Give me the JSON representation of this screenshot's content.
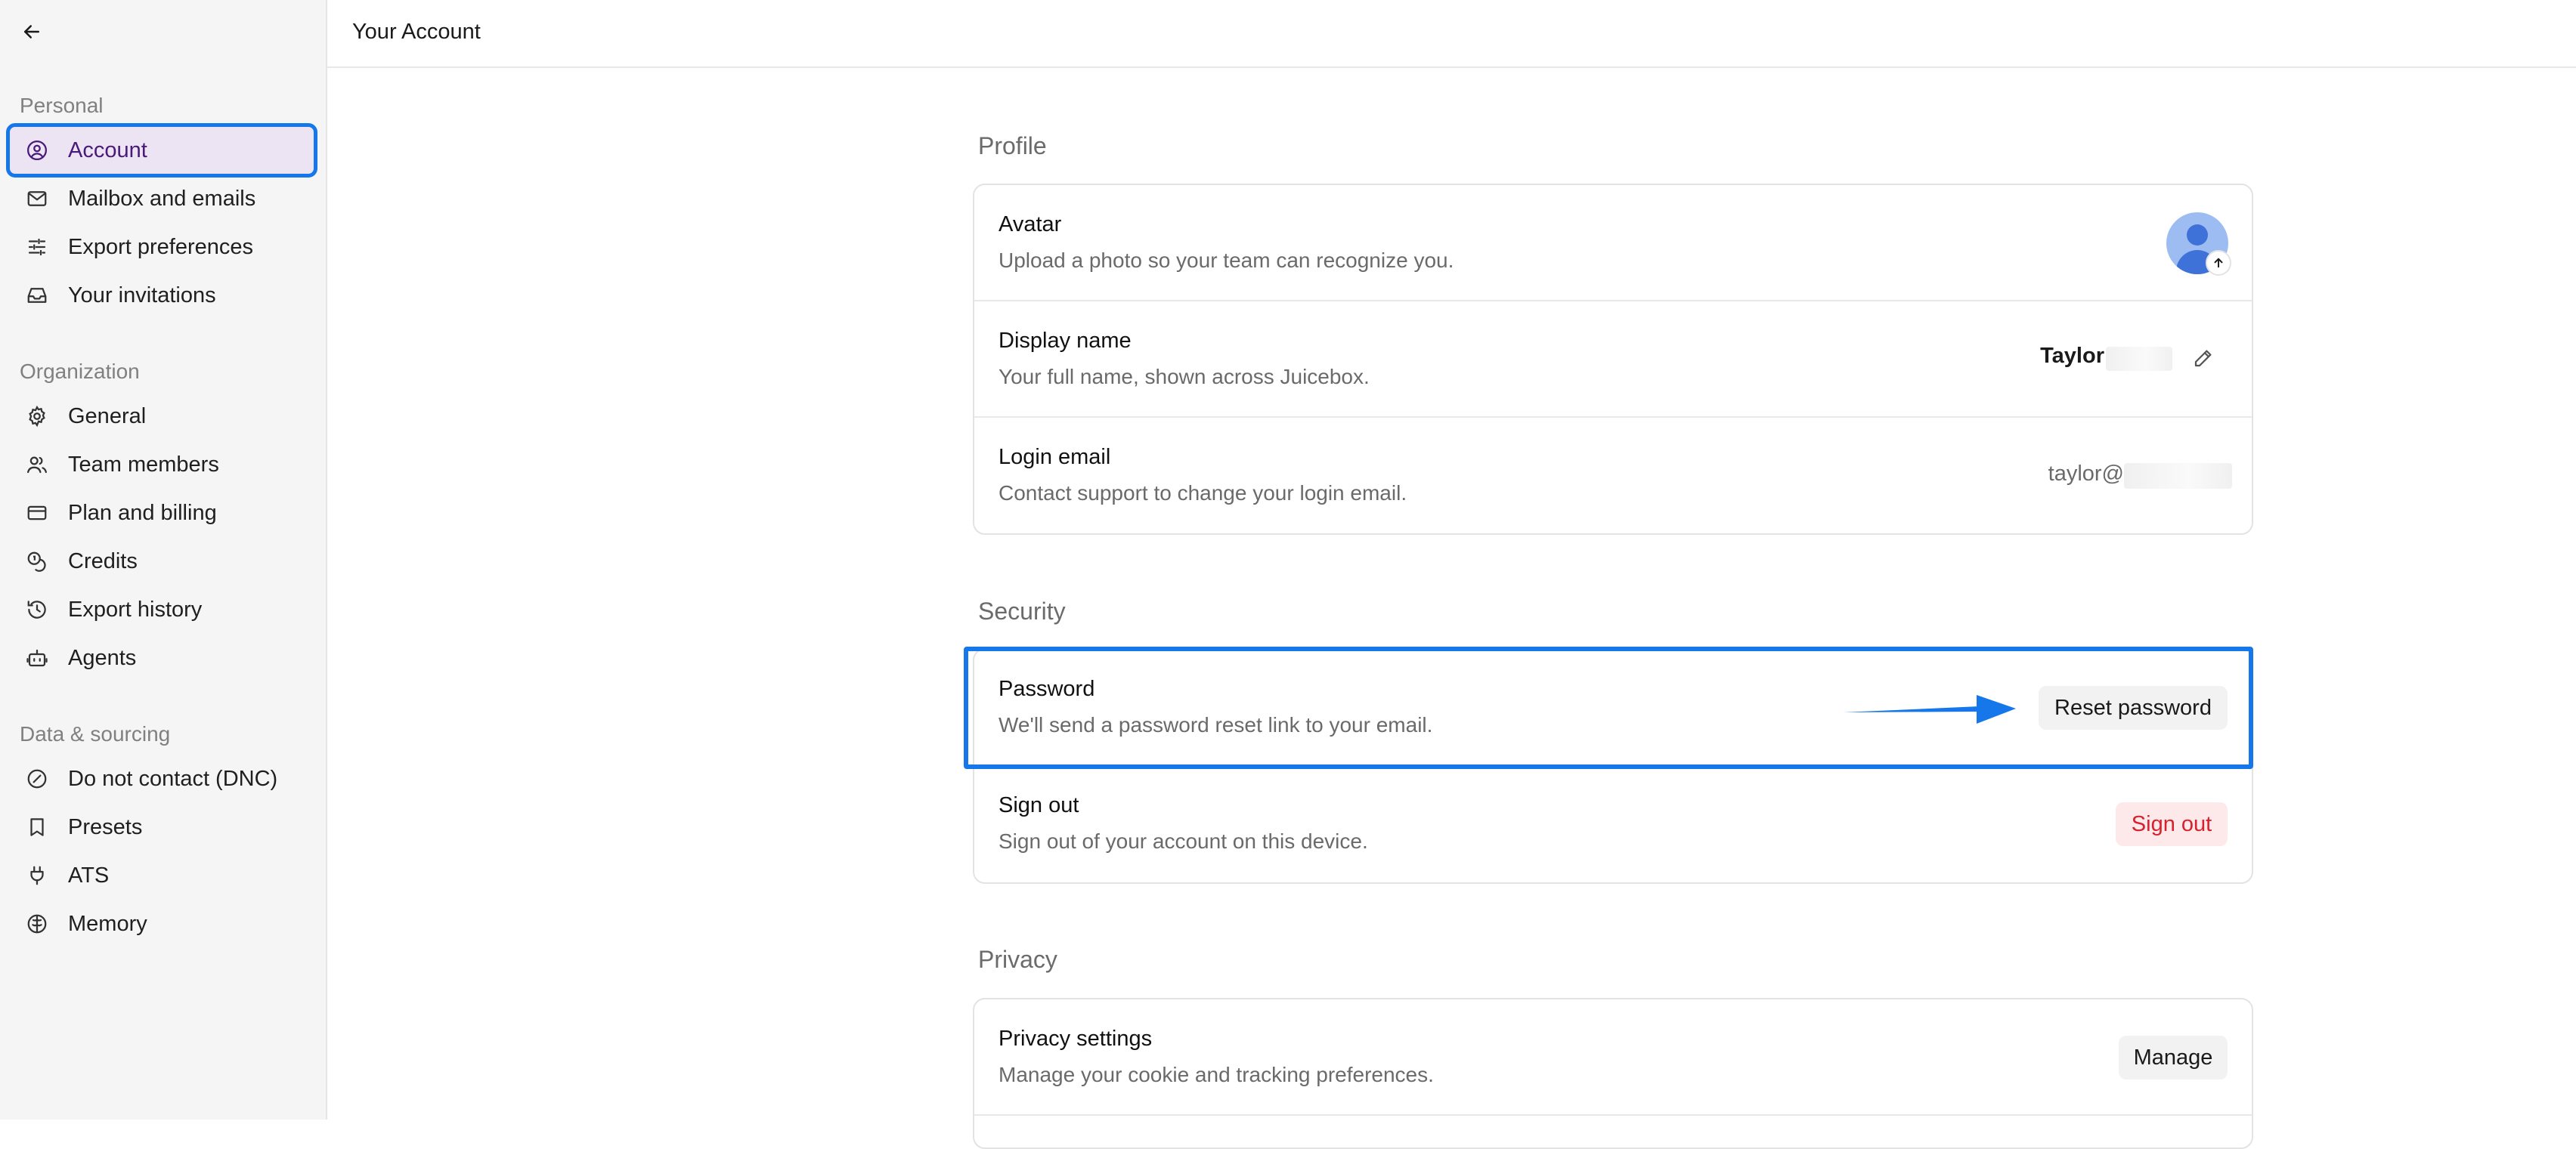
{
  "topbar": {
    "title": "Your Account"
  },
  "sidebar": {
    "groups": [
      {
        "label": "Personal",
        "items": [
          {
            "label": "Account",
            "icon": "user-circle-icon"
          },
          {
            "label": "Mailbox and emails",
            "icon": "mail-icon"
          },
          {
            "label": "Export preferences",
            "icon": "sliders-icon"
          },
          {
            "label": "Your invitations",
            "icon": "inbox-icon"
          }
        ]
      },
      {
        "label": "Organization",
        "items": [
          {
            "label": "General",
            "icon": "gear-icon"
          },
          {
            "label": "Team members",
            "icon": "users-icon"
          },
          {
            "label": "Plan and billing",
            "icon": "credit-card-icon"
          },
          {
            "label": "Credits",
            "icon": "coins-icon"
          },
          {
            "label": "Export history",
            "icon": "history-icon"
          },
          {
            "label": "Agents",
            "icon": "bot-icon"
          }
        ]
      },
      {
        "label": "Data & sourcing",
        "items": [
          {
            "label": "Do not contact (DNC)",
            "icon": "ban-icon"
          },
          {
            "label": "Presets",
            "icon": "bookmark-icon"
          },
          {
            "label": "ATS",
            "icon": "plug-icon"
          },
          {
            "label": "Memory",
            "icon": "brain-icon"
          }
        ]
      }
    ]
  },
  "profile": {
    "title": "Profile",
    "avatar": {
      "title": "Avatar",
      "desc": "Upload a photo so your team can recognize you."
    },
    "display_name": {
      "title": "Display name",
      "desc": "Your full name, shown across Juicebox.",
      "value": "Taylor"
    },
    "login_email": {
      "title": "Login email",
      "desc": "Contact support to change your login email.",
      "value": "taylor@"
    }
  },
  "security": {
    "title": "Security",
    "password": {
      "title": "Password",
      "desc": "We'll send a password reset link to your email.",
      "button": "Reset password"
    },
    "signout": {
      "title": "Sign out",
      "desc": "Sign out of your account on this device.",
      "button": "Sign out"
    }
  },
  "privacy": {
    "title": "Privacy",
    "settings": {
      "title": "Privacy settings",
      "desc": "Manage your cookie and tracking preferences.",
      "button": "Manage"
    }
  },
  "colors": {
    "accent": "#1677ea",
    "active_bg": "#ece4f2",
    "active_text": "#4a1a7a",
    "danger": "#d8202e",
    "danger_bg": "#fde9ea"
  }
}
